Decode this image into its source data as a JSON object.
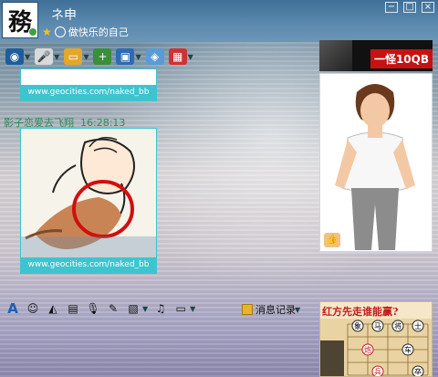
{
  "titlebar": {
    "avatar_glyph": "務",
    "nickname": "ネ申",
    "signature": "做快乐的自己",
    "window_buttons": [
      "−",
      "□",
      "×"
    ]
  },
  "chat": {
    "image_caption_1": "www.geocities.com/naked_bb",
    "sender": "影子恋爱去飞翔",
    "timestamp": "16:28:13",
    "image_caption_2": "www.geocities.com/naked_bb"
  },
  "ad": {
    "banner_text": "一怪10QB"
  },
  "input_toolbar": {
    "history_label": "消息记录"
  },
  "game": {
    "title": "红方先走谁能赢?",
    "pieces": [
      "象",
      "马",
      "将",
      "士",
      "炮",
      "车",
      "兵",
      "卒"
    ]
  },
  "colors": {
    "titlebar": "#4a7aa3",
    "caption_bar": "#3ec4cf",
    "sender_color": "#2e8b57",
    "red_circle": "#d10f0f"
  }
}
